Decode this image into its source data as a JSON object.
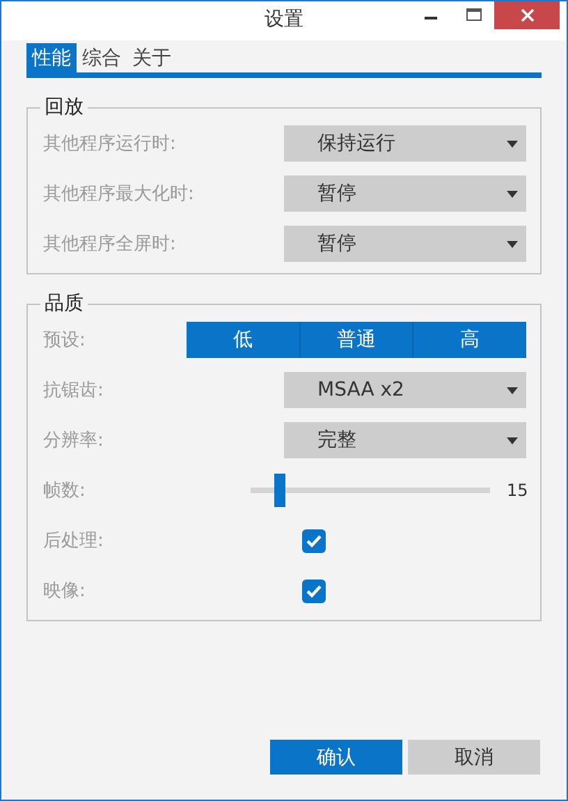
{
  "window": {
    "title": "设置"
  },
  "tabs": [
    {
      "label": "性能",
      "selected": true
    },
    {
      "label": "综合",
      "selected": false
    },
    {
      "label": "关于",
      "selected": false
    }
  ],
  "playback": {
    "title": "回放",
    "rows": [
      {
        "label": "其他程序运行时:",
        "value": "保持运行"
      },
      {
        "label": "其他程序最大化时:",
        "value": "暂停"
      },
      {
        "label": "其他程序全屏时:",
        "value": "暂停"
      }
    ]
  },
  "quality": {
    "title": "品质",
    "rows": [
      {
        "kind": "segmented",
        "label": "预设:",
        "options": [
          {
            "label": "低",
            "selected": false
          },
          {
            "label": "普通",
            "selected": false
          },
          {
            "label": "高",
            "selected": false
          }
        ]
      },
      {
        "kind": "dropdown",
        "label": "抗锯齿:",
        "value": "MSAA x2"
      },
      {
        "kind": "dropdown",
        "label": "分辨率:",
        "value": "完整"
      },
      {
        "kind": "slider",
        "label": "帧数:",
        "level": 0.12,
        "reading": "15"
      },
      {
        "kind": "checkbox",
        "label": "后处理:",
        "checked": true
      },
      {
        "kind": "checkbox",
        "label": "映像:",
        "checked": true
      }
    ]
  },
  "buttons": [
    {
      "label": "确认",
      "kind": "primary"
    },
    {
      "label": "取消",
      "kind": "secondary"
    }
  ]
}
